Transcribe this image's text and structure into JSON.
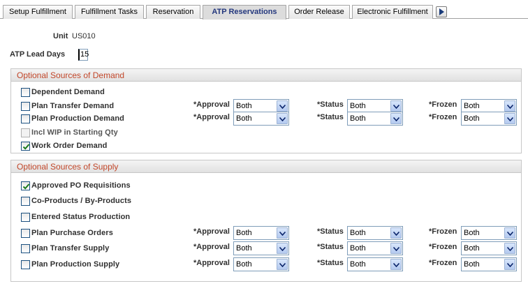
{
  "tabs": [
    {
      "label": "Setup Fulfillment",
      "active": false
    },
    {
      "label": "Fulfillment Tasks",
      "active": false
    },
    {
      "label": "Reservation",
      "active": false
    },
    {
      "label": "ATP Reservations",
      "active": true
    },
    {
      "label": "Order Release",
      "active": false
    },
    {
      "label": "Electronic Fulfillment",
      "active": false
    }
  ],
  "tab_next_icon": "play-right-icon",
  "unit": {
    "label": "Unit",
    "value": "US010"
  },
  "lead_days": {
    "label": "ATP Lead Days",
    "value": "15"
  },
  "demand": {
    "title": "Optional Sources of Demand",
    "items": [
      {
        "label": "Dependent Demand",
        "checked": false,
        "disabled": false
      },
      {
        "label": "Plan Transfer Demand",
        "checked": false,
        "disabled": false,
        "approval": "Both",
        "status": "Both",
        "frozen": "Both"
      },
      {
        "label": "Plan Production Demand",
        "checked": false,
        "disabled": false,
        "approval": "Both",
        "status": "Both",
        "frozen": "Both"
      },
      {
        "label": "Incl WIP in Starting Qty",
        "checked": false,
        "disabled": true
      },
      {
        "label": "Work Order Demand",
        "checked": true,
        "disabled": false
      }
    ]
  },
  "supply": {
    "title": "Optional Sources of Supply",
    "items": [
      {
        "label": "Approved PO Requisitions",
        "checked": true,
        "disabled": false
      },
      {
        "label": "Co-Products / By-Products",
        "checked": false,
        "disabled": false
      },
      {
        "label": "Entered Status Production",
        "checked": false,
        "disabled": false
      },
      {
        "label": "Plan Purchase Orders",
        "checked": false,
        "disabled": false,
        "approval": "Both",
        "status": "Both",
        "frozen": "Both"
      },
      {
        "label": "Plan Transfer Supply",
        "checked": false,
        "disabled": false,
        "approval": "Both",
        "status": "Both",
        "frozen": "Both"
      },
      {
        "label": "Plan Production Supply",
        "checked": false,
        "disabled": false,
        "approval": "Both",
        "status": "Both",
        "frozen": "Both"
      }
    ]
  },
  "field_labels": {
    "approval": "*Approval",
    "status": "*Status",
    "frozen": "*Frozen"
  },
  "colors": {
    "section_title": "#c2472a",
    "active_tab": "#24387e"
  }
}
